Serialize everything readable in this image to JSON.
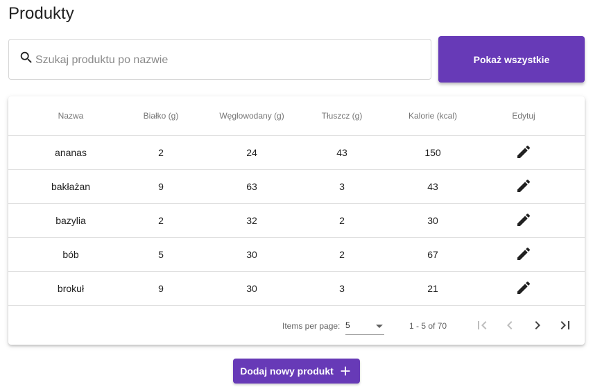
{
  "page": {
    "title": "Produkty"
  },
  "search": {
    "placeholder": "Szukaj produktu po nazwie",
    "value": ""
  },
  "actions": {
    "show_all_label": "Pokaż wszystkie",
    "add_label": "Dodaj nowy produkt"
  },
  "colors": {
    "primary": "#673ab7"
  },
  "table": {
    "headers": [
      "Nazwa",
      "Białko (g)",
      "Węglowodany (g)",
      "Tłuszcz (g)",
      "Kalorie (kcal)",
      "Edytuj"
    ],
    "rows": [
      [
        "ananas",
        "2",
        "24",
        "43",
        "150"
      ],
      [
        "bakłażan",
        "9",
        "63",
        "3",
        "43"
      ],
      [
        "bazylia",
        "2",
        "32",
        "2",
        "30"
      ],
      [
        "bób",
        "5",
        "30",
        "2",
        "67"
      ],
      [
        "brokuł",
        "9",
        "30",
        "3",
        "21"
      ]
    ],
    "row_icon": "edit-icon"
  },
  "paginator": {
    "items_per_page_label": "Items per page:",
    "page_size": "5",
    "range_label": "1 - 5 of 70",
    "icons": [
      "first-page-icon",
      "previous-page-icon",
      "next-page-icon",
      "last-page-icon"
    ]
  }
}
